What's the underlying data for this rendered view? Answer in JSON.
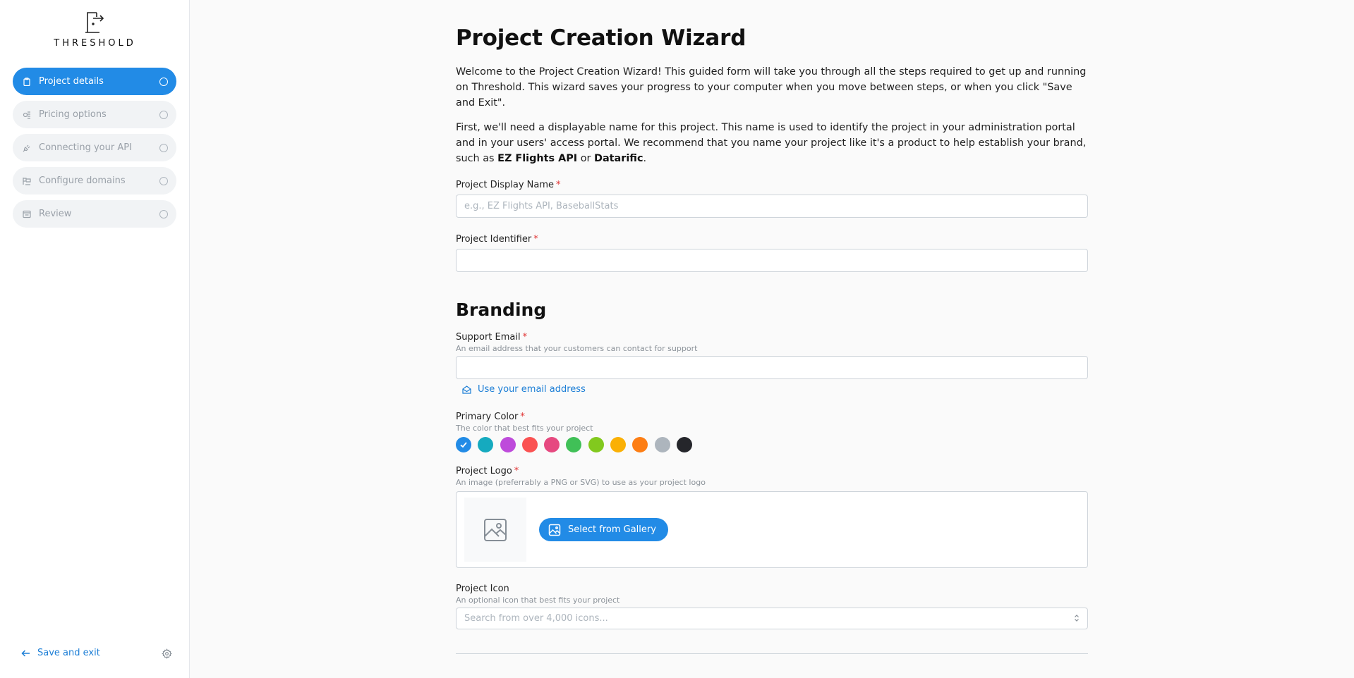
{
  "brand": {
    "name": "THRESHOLD"
  },
  "steps": [
    {
      "label": "Project details",
      "icon": "clipboard-icon",
      "active": true
    },
    {
      "label": "Pricing options",
      "icon": "coins-icon",
      "active": false
    },
    {
      "label": "Connecting your API",
      "icon": "plug-icon",
      "active": false
    },
    {
      "label": "Configure domains",
      "icon": "world-icon",
      "active": false
    },
    {
      "label": "Review",
      "icon": "list-check-icon",
      "active": false
    }
  ],
  "footer": {
    "save_exit": "Save and exit"
  },
  "page": {
    "title": "Project Creation Wizard",
    "intro1": "Welcome to the Project Creation Wizard! This guided form will take you through all the steps required to get up and running on Threshold. This wizard saves your progress to your computer when you move between steps, or when you click \"Save and Exit\".",
    "intro2_prefix": "First, we'll need a displayable name for this project. This name is used to identify the project in your administration portal and in your users' access portal. We recommend that you name your project like it's a product to help establish your brand, such as ",
    "intro2_bold1": "EZ Flights API",
    "intro2_mid": " or ",
    "intro2_bold2": "Datarific",
    "intro2_suffix": "."
  },
  "fields": {
    "display_name": {
      "label": "Project Display Name",
      "required": "*",
      "placeholder": "e.g., EZ Flights API, BaseballStats",
      "value": ""
    },
    "identifier": {
      "label": "Project Identifier",
      "required": "*",
      "value": ""
    }
  },
  "branding": {
    "heading": "Branding",
    "support_email": {
      "label": "Support Email",
      "required": "*",
      "description": "An email address that your customers can contact for support",
      "value": "",
      "use_email": "Use your email address"
    },
    "primary_color": {
      "label": "Primary Color",
      "required": "*",
      "description": "The color that best fits your project",
      "selected": 0,
      "colors": [
        "#228be6",
        "#15aabf",
        "#be4bdb",
        "#fa5252",
        "#e64980",
        "#40c057",
        "#82c91e",
        "#fab005",
        "#fd7e14",
        "#adb5bd",
        "#25262b"
      ]
    },
    "project_logo": {
      "label": "Project Logo",
      "required": "*",
      "description": "An image (preferrably a PNG or SVG) to use as your project logo",
      "button": "Select from Gallery"
    },
    "project_icon": {
      "label": "Project Icon",
      "description": "An optional icon that best fits your project",
      "placeholder": "Search from over 4,000 icons..."
    }
  }
}
